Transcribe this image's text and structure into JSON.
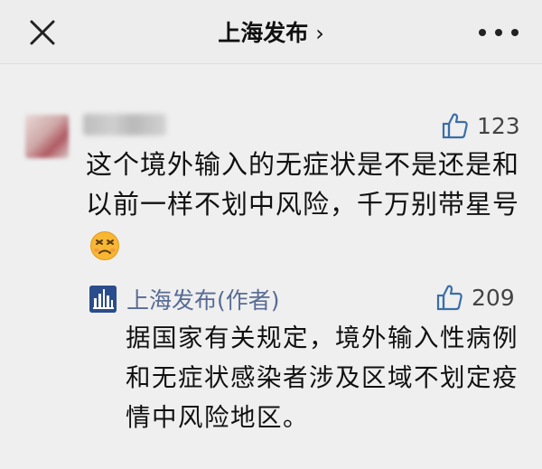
{
  "header": {
    "title": "上海发布",
    "title_chevron": "›"
  },
  "comment": {
    "likes": "123",
    "text": "这个境外输入的无症状是不是还是和以前一样不划中风险，千万别带星号"
  },
  "reply": {
    "author": "上海发布(作者)",
    "likes": "209",
    "text": "据国家有关规定，境外输入性病例和无症状感染者涉及区域不划定疫情中风险地区。"
  },
  "colors": {
    "background": "#efefef",
    "author_link": "#576b95"
  }
}
